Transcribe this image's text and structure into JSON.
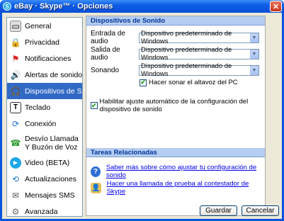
{
  "window": {
    "title": "eBay · Skype™ · Opciones",
    "app_icon": "S"
  },
  "sidebar": {
    "items": [
      {
        "label": "General",
        "icon": "general-icon"
      },
      {
        "label": "Privacidad",
        "icon": "privacy-icon"
      },
      {
        "label": "Notificaciones",
        "icon": "flag-icon"
      },
      {
        "label": "Alertas de sonido",
        "icon": "speaker-icon"
      },
      {
        "label": "Dispositivos de Soni",
        "icon": "headset-icon",
        "active": true
      },
      {
        "label": "Teclado",
        "icon": "keyboard-icon"
      },
      {
        "label": "Conexión",
        "icon": "connection-icon"
      },
      {
        "label": "Desvío Llamada\nY Buzón de Voz",
        "icon": "voicemail-icon"
      },
      {
        "label": "Video (BETA)",
        "icon": "video-icon"
      },
      {
        "label": "Actualizaciones",
        "icon": "update-icon"
      },
      {
        "label": "Mensajes SMS",
        "icon": "sms-icon"
      },
      {
        "label": "Avanzada",
        "icon": "gear-icon"
      }
    ]
  },
  "audio": {
    "header": "Dispositivos de Sonido",
    "input_label": "Entrada de audio",
    "input_value": "Dispositivo predeterminado de Windows",
    "output_label": "Salida de audio",
    "output_value": "Dispositivo predeterminado de Windows",
    "ring_label": "Sonando",
    "ring_value": "Dispositivo predeterminado de Windows",
    "speaker_check_label": "Hacer sonar el altavoz del PC",
    "auto_adjust_label": "Habilitar ajuste automático de la configuración del dispositivo de sonido"
  },
  "related": {
    "header": "Tareas Relacionadas",
    "link1": "Saber más sobre cómo ajustar tu configuración de sonido",
    "link2": "Hacer una llamada de prueba al contestador de Skype"
  },
  "buttons": {
    "save": "Guardar",
    "cancel": "Cancelar"
  }
}
